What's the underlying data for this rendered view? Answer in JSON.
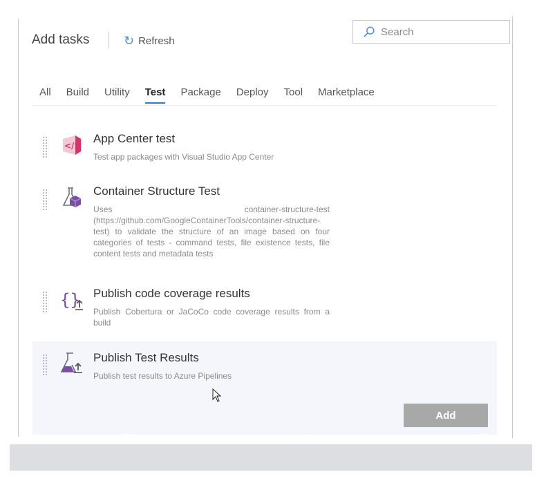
{
  "header": {
    "title": "Add tasks",
    "refresh_label": "Refresh",
    "refresh_icon": "refresh-icon",
    "search_placeholder": "Search",
    "search_icon": "search-icon"
  },
  "tabs": [
    {
      "label": "All",
      "active": false
    },
    {
      "label": "Build",
      "active": false
    },
    {
      "label": "Utility",
      "active": false
    },
    {
      "label": "Test",
      "active": true
    },
    {
      "label": "Package",
      "active": false
    },
    {
      "label": "Deploy",
      "active": false
    },
    {
      "label": "Tool",
      "active": false
    },
    {
      "label": "Marketplace",
      "active": false
    }
  ],
  "tasks": [
    {
      "title": "App Center test",
      "description": "Test app packages with Visual Studio App Center",
      "icon": "app-center-icon"
    },
    {
      "title": "Container Structure Test",
      "description": "Uses container-structure-test (https://github.com/GoogleContainerTools/container-structure-test) to validate the structure of an image based on four categories of tests - command tests, file existence tests, file content tests and metadata tests",
      "icon": "flask-container-icon"
    },
    {
      "title": "Publish code coverage results",
      "description": "Publish Cobertura or JaCoCo code coverage results from a build",
      "icon": "code-coverage-icon"
    },
    {
      "title": "Publish Test Results",
      "description": "Publish test results to Azure Pipelines",
      "icon": "flask-upload-icon",
      "selected": true
    }
  ],
  "footer": {
    "add_label": "Add"
  },
  "colors": {
    "accent": "#2e7bcf",
    "app_center": "#d6336c",
    "flask": "#7a4fa3",
    "add_button": "#a8a8a8"
  }
}
